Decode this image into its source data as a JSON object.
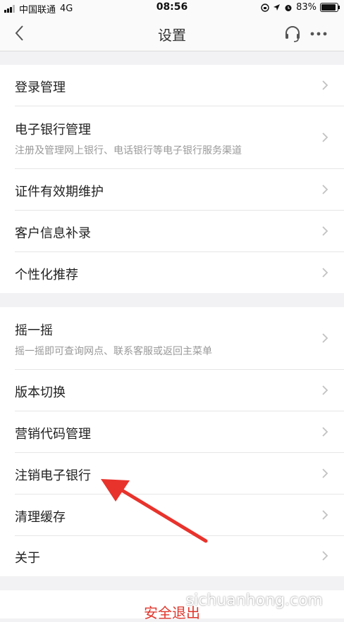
{
  "status_bar": {
    "carrier": "中国联通",
    "network": "4G",
    "time": "08:56",
    "battery": "83%",
    "battery_level": 0.83
  },
  "nav": {
    "title": "设置",
    "back_icon": "chevron-left-icon",
    "service_icon": "headset-icon",
    "more_icon": "more-dots-icon"
  },
  "group1": {
    "items": [
      {
        "label": "登录管理"
      },
      {
        "label": "电子银行管理",
        "sub": "注册及管理网上银行、电话银行等电子银行服务渠道"
      },
      {
        "label": "证件有效期维护"
      },
      {
        "label": "客户信息补录"
      },
      {
        "label": "个性化推荐"
      }
    ]
  },
  "group2": {
    "items": [
      {
        "label": "摇一摇",
        "sub": "摇一摇即可查询网点、联系客服或返回主菜单"
      },
      {
        "label": "版本切换"
      },
      {
        "label": "营销代码管理"
      },
      {
        "label": "注销电子银行"
      },
      {
        "label": "清理缓存"
      },
      {
        "label": "关于"
      }
    ]
  },
  "logout": {
    "label": "安全退出"
  },
  "watermark": "sichuanhong.com",
  "colors": {
    "accent_red": "#e0362c",
    "annotation_arrow": "#e8332c"
  }
}
